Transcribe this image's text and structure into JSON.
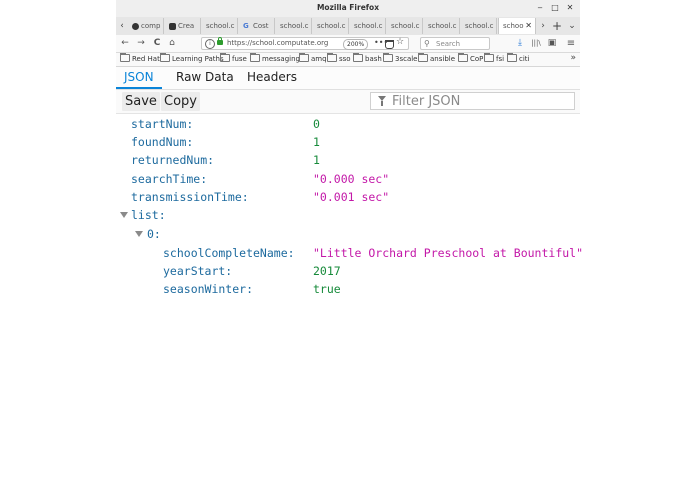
{
  "window": {
    "title": "Mozilla Firefox",
    "controls": {
      "minimize": "‒",
      "maximize": "□",
      "close": "✕"
    }
  },
  "tabs": {
    "scroll_left": "‹",
    "scroll_right": "›",
    "new_tab": "+",
    "list": "⌄",
    "items": [
      {
        "label": "comp",
        "icon": "github-icon"
      },
      {
        "label": "Crea",
        "icon": "app-icon"
      },
      {
        "label": "school.c",
        "icon": ""
      },
      {
        "label": "Cost",
        "icon": "google-icon",
        "icon_glyph": "G"
      },
      {
        "label": "school.c",
        "icon": ""
      },
      {
        "label": "school.c",
        "icon": ""
      },
      {
        "label": "school.c",
        "icon": ""
      },
      {
        "label": "school.c",
        "icon": ""
      },
      {
        "label": "school.c",
        "icon": ""
      },
      {
        "label": "school.c",
        "icon": ""
      },
      {
        "label": "schoo",
        "icon": "",
        "active": true
      }
    ],
    "close_glyph": "✕"
  },
  "navbar": {
    "back": "←",
    "forward": "→",
    "reload": "C",
    "home": "⌂",
    "info": "i",
    "url": "https://school.computate.org",
    "zoom": "200%",
    "more": "•••",
    "star": "☆",
    "search_placeholder": "Search",
    "search_glyph": "⚲",
    "download": "⤓",
    "library": "|||\\",
    "sidebar": "▣",
    "menu": "≡"
  },
  "bookmarks": {
    "items": [
      "Red Hat",
      "Learning Paths",
      "fuse",
      "messaging",
      "amq",
      "sso",
      "bash",
      "3scale",
      "ansible",
      "CoP",
      "fsi",
      "citi"
    ],
    "overflow": "»"
  },
  "viewer": {
    "tabs": [
      "JSON",
      "Raw Data",
      "Headers"
    ],
    "active_tab": "JSON",
    "toolbar": {
      "save": "Save",
      "copy": "Copy",
      "filter_placeholder": "Filter JSON"
    }
  },
  "json": {
    "rows": [
      {
        "key": "startNum:",
        "value": "0",
        "type": "num"
      },
      {
        "key": "foundNum:",
        "value": "1",
        "type": "num"
      },
      {
        "key": "returnedNum:",
        "value": "1",
        "type": "num"
      },
      {
        "key": "searchTime:",
        "value": "\"0.000 sec\"",
        "type": "str"
      },
      {
        "key": "transmissionTime:",
        "value": "\"0.001 sec\"",
        "type": "str"
      },
      {
        "key": "list:",
        "value": "",
        "type": "obj",
        "expanded": true
      },
      {
        "key": "0:",
        "value": "",
        "type": "obj",
        "expanded": true
      },
      {
        "key": "schoolCompleteName:",
        "value": "\"Little Orchard Preschool at Bountiful\"",
        "type": "str"
      },
      {
        "key": "yearStart:",
        "value": "2017",
        "type": "num"
      },
      {
        "key": "seasonWinter:",
        "value": "true",
        "type": "bool"
      }
    ]
  }
}
